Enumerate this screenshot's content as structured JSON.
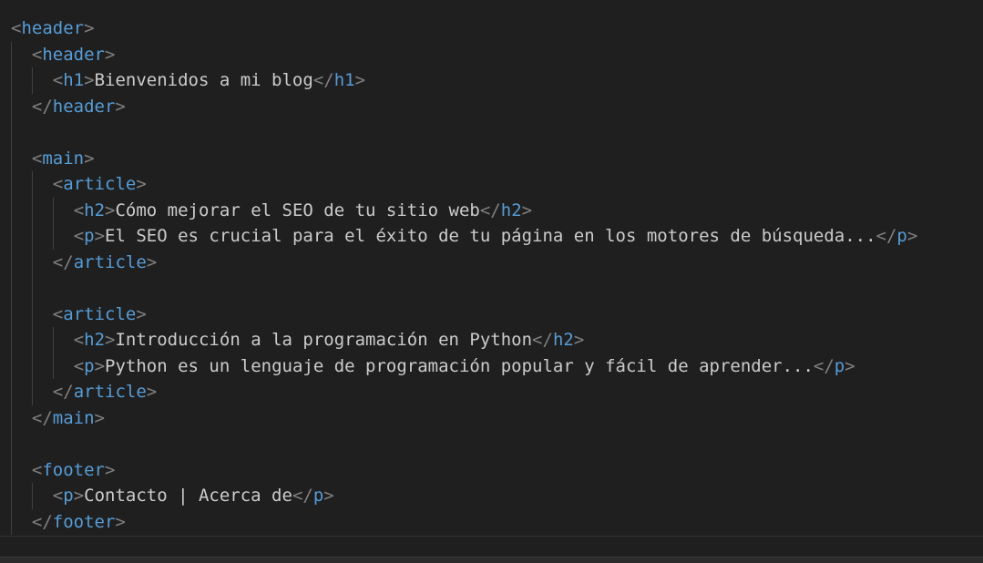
{
  "editor": {
    "colors": {
      "background": "#1f1f1f",
      "bracket": "#808080",
      "tag": "#569cd6",
      "text": "#cccccc",
      "indent_guide": "#404040"
    },
    "lines": [
      {
        "indent": 0,
        "tokens": [
          {
            "t": "br",
            "v": "<"
          },
          {
            "t": "tg",
            "v": "header"
          },
          {
            "t": "br",
            "v": ">"
          }
        ]
      },
      {
        "indent": 1,
        "tokens": [
          {
            "t": "br",
            "v": "<"
          },
          {
            "t": "tg",
            "v": "header"
          },
          {
            "t": "br",
            "v": ">"
          }
        ]
      },
      {
        "indent": 2,
        "tokens": [
          {
            "t": "br",
            "v": "<"
          },
          {
            "t": "tg",
            "v": "h1"
          },
          {
            "t": "br",
            "v": ">"
          },
          {
            "t": "tx",
            "v": "Bienvenidos a mi blog"
          },
          {
            "t": "br",
            "v": "</"
          },
          {
            "t": "tg",
            "v": "h1"
          },
          {
            "t": "br",
            "v": ">"
          }
        ]
      },
      {
        "indent": 1,
        "tokens": [
          {
            "t": "br",
            "v": "</"
          },
          {
            "t": "tg",
            "v": "header"
          },
          {
            "t": "br",
            "v": ">"
          }
        ]
      },
      {
        "indent": 1,
        "tokens": []
      },
      {
        "indent": 1,
        "tokens": [
          {
            "t": "br",
            "v": "<"
          },
          {
            "t": "tg",
            "v": "main"
          },
          {
            "t": "br",
            "v": ">"
          }
        ]
      },
      {
        "indent": 2,
        "tokens": [
          {
            "t": "br",
            "v": "<"
          },
          {
            "t": "tg",
            "v": "article"
          },
          {
            "t": "br",
            "v": ">"
          }
        ]
      },
      {
        "indent": 3,
        "tokens": [
          {
            "t": "br",
            "v": "<"
          },
          {
            "t": "tg",
            "v": "h2"
          },
          {
            "t": "br",
            "v": ">"
          },
          {
            "t": "tx",
            "v": "Cómo mejorar el SEO de tu sitio web"
          },
          {
            "t": "br",
            "v": "</"
          },
          {
            "t": "tg",
            "v": "h2"
          },
          {
            "t": "br",
            "v": ">"
          }
        ]
      },
      {
        "indent": 3,
        "tokens": [
          {
            "t": "br",
            "v": "<"
          },
          {
            "t": "tg",
            "v": "p"
          },
          {
            "t": "br",
            "v": ">"
          },
          {
            "t": "tx",
            "v": "El SEO es crucial para el éxito de tu página en los motores de búsqueda..."
          },
          {
            "t": "br",
            "v": "</"
          },
          {
            "t": "tg",
            "v": "p"
          },
          {
            "t": "br",
            "v": ">"
          }
        ]
      },
      {
        "indent": 2,
        "tokens": [
          {
            "t": "br",
            "v": "</"
          },
          {
            "t": "tg",
            "v": "article"
          },
          {
            "t": "br",
            "v": ">"
          }
        ]
      },
      {
        "indent": 2,
        "tokens": []
      },
      {
        "indent": 2,
        "tokens": [
          {
            "t": "br",
            "v": "<"
          },
          {
            "t": "tg",
            "v": "article"
          },
          {
            "t": "br",
            "v": ">"
          }
        ]
      },
      {
        "indent": 3,
        "tokens": [
          {
            "t": "br",
            "v": "<"
          },
          {
            "t": "tg",
            "v": "h2"
          },
          {
            "t": "br",
            "v": ">"
          },
          {
            "t": "tx",
            "v": "Introducción a la programación en Python"
          },
          {
            "t": "br",
            "v": "</"
          },
          {
            "t": "tg",
            "v": "h2"
          },
          {
            "t": "br",
            "v": ">"
          }
        ]
      },
      {
        "indent": 3,
        "tokens": [
          {
            "t": "br",
            "v": "<"
          },
          {
            "t": "tg",
            "v": "p"
          },
          {
            "t": "br",
            "v": ">"
          },
          {
            "t": "tx",
            "v": "Python es un lenguaje de programación popular y fácil de aprender..."
          },
          {
            "t": "br",
            "v": "</"
          },
          {
            "t": "tg",
            "v": "p"
          },
          {
            "t": "br",
            "v": ">"
          }
        ]
      },
      {
        "indent": 2,
        "tokens": [
          {
            "t": "br",
            "v": "</"
          },
          {
            "t": "tg",
            "v": "article"
          },
          {
            "t": "br",
            "v": ">"
          }
        ]
      },
      {
        "indent": 1,
        "tokens": [
          {
            "t": "br",
            "v": "</"
          },
          {
            "t": "tg",
            "v": "main"
          },
          {
            "t": "br",
            "v": ">"
          }
        ]
      },
      {
        "indent": 1,
        "tokens": []
      },
      {
        "indent": 1,
        "tokens": [
          {
            "t": "br",
            "v": "<"
          },
          {
            "t": "tg",
            "v": "footer"
          },
          {
            "t": "br",
            "v": ">"
          }
        ]
      },
      {
        "indent": 2,
        "tokens": [
          {
            "t": "br",
            "v": "<"
          },
          {
            "t": "tg",
            "v": "p"
          },
          {
            "t": "br",
            "v": ">"
          },
          {
            "t": "tx",
            "v": "Contacto | Acerca de"
          },
          {
            "t": "br",
            "v": "</"
          },
          {
            "t": "tg",
            "v": "p"
          },
          {
            "t": "br",
            "v": ">"
          }
        ]
      },
      {
        "indent": 1,
        "tokens": [
          {
            "t": "br",
            "v": "</"
          },
          {
            "t": "tg",
            "v": "footer"
          },
          {
            "t": "br",
            "v": ">"
          }
        ]
      }
    ]
  }
}
